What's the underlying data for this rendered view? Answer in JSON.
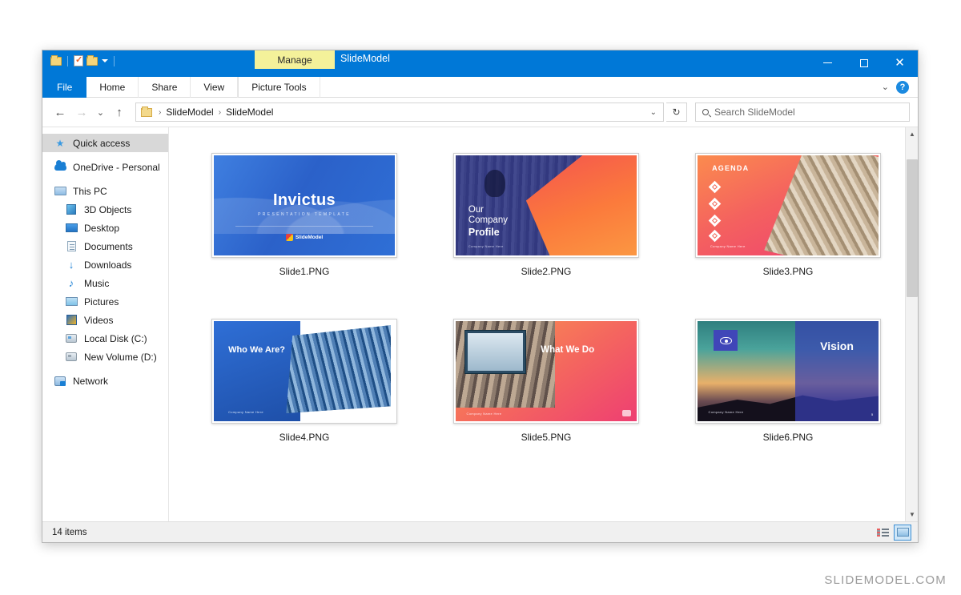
{
  "window": {
    "title": "SlideModel",
    "contextual_tab_group": "Manage",
    "quick_access": [
      {
        "icon": "folder-icon",
        "name": "quick-access-folder"
      },
      {
        "icon": "properties-icon",
        "name": "quick-access-properties"
      },
      {
        "icon": "new-folder-icon",
        "name": "quick-access-new-folder"
      },
      {
        "icon": "chevron-down-icon",
        "name": "quick-access-customize"
      }
    ],
    "controls": {
      "minimize": "minimize-icon",
      "maximize": "maximize-icon",
      "close": "close-icon"
    }
  },
  "ribbon": {
    "tabs": [
      {
        "label": "File",
        "id": "file"
      },
      {
        "label": "Home",
        "id": "home"
      },
      {
        "label": "Share",
        "id": "share"
      },
      {
        "label": "View",
        "id": "view"
      },
      {
        "label": "Picture Tools",
        "id": "picture-tools"
      }
    ],
    "collapse_icon": "chevron-down-icon",
    "help_label": "?"
  },
  "address": {
    "back_icon": "arrow-left-icon",
    "forward_icon": "arrow-right-icon",
    "recent_icon": "chevron-down-icon",
    "up_icon": "arrow-up-icon",
    "breadcrumb": [
      "SlideModel",
      "SlideModel"
    ],
    "separator": "›",
    "dropdown_icon": "chevron-down-icon",
    "refresh_icon": "refresh-icon",
    "search_placeholder": "Search SlideModel",
    "search_value": "",
    "search_icon": "search-icon"
  },
  "sidebar": {
    "items": [
      {
        "label": "Quick access",
        "icon": "star-icon",
        "indent": false,
        "selected": true,
        "gap_before": false
      },
      {
        "label": "OneDrive - Personal",
        "icon": "cloud-icon",
        "indent": false,
        "selected": false,
        "gap_before": true
      },
      {
        "label": "This PC",
        "icon": "pc-icon",
        "indent": false,
        "selected": false,
        "gap_before": true
      },
      {
        "label": "3D Objects",
        "icon": "3d-objects-icon",
        "indent": true,
        "selected": false,
        "gap_before": false
      },
      {
        "label": "Desktop",
        "icon": "desktop-icon",
        "indent": true,
        "selected": false,
        "gap_before": false
      },
      {
        "label": "Documents",
        "icon": "documents-icon",
        "indent": true,
        "selected": false,
        "gap_before": false
      },
      {
        "label": "Downloads",
        "icon": "downloads-icon",
        "indent": true,
        "selected": false,
        "gap_before": false
      },
      {
        "label": "Music",
        "icon": "music-icon",
        "indent": true,
        "selected": false,
        "gap_before": false
      },
      {
        "label": "Pictures",
        "icon": "pictures-icon",
        "indent": true,
        "selected": false,
        "gap_before": false
      },
      {
        "label": "Videos",
        "icon": "videos-icon",
        "indent": true,
        "selected": false,
        "gap_before": false
      },
      {
        "label": "Local Disk (C:)",
        "icon": "disk-icon",
        "indent": true,
        "selected": false,
        "gap_before": false
      },
      {
        "label": "New Volume (D:)",
        "icon": "disk-icon",
        "indent": true,
        "selected": false,
        "gap_before": false
      },
      {
        "label": "Network",
        "icon": "network-icon",
        "indent": false,
        "selected": false,
        "gap_before": true
      }
    ]
  },
  "files": [
    {
      "label": "Slide1.PNG",
      "preview": {
        "id": "invictus",
        "title": "Invictus",
        "subtitle": "PRESENTATION TEMPLATE",
        "logo_text": "SlideModel",
        "bg_color": "#2f6fd6"
      }
    },
    {
      "label": "Slide2.PNG",
      "preview": {
        "id": "company-profile",
        "line1": "Our",
        "line2": "Company",
        "line3": "Profile",
        "footer": "Company Name Here",
        "bg_color": "#262a75",
        "accent_color": "#fb7a3c"
      }
    },
    {
      "label": "Slide3.PNG",
      "preview": {
        "id": "agenda",
        "title": "AGENDA",
        "bullet_count": 4,
        "footer": "Company Name Here",
        "bg_color": "#f4615f"
      }
    },
    {
      "label": "Slide4.PNG",
      "preview": {
        "id": "who-we-are",
        "title": "Who We Are?",
        "footer": "Company Name Here",
        "bg_color": "#2f6fd6"
      }
    },
    {
      "label": "Slide5.PNG",
      "preview": {
        "id": "what-we-do",
        "title": "What We Do",
        "footer": "Company Name Here",
        "bg_color": "#f4655f"
      }
    },
    {
      "label": "Slide6.PNG",
      "preview": {
        "id": "vision",
        "title": "Vision",
        "icon": "eye-icon",
        "footer": "Company Name Here",
        "page_number": "5",
        "bg_color": "#383eb2"
      }
    }
  ],
  "status": {
    "item_count": "14 items",
    "views": [
      {
        "id": "details-view",
        "label": "Details view",
        "active": false
      },
      {
        "id": "large-icons-view",
        "label": "Large icons view",
        "active": true
      }
    ]
  },
  "scrollbar": {
    "up_icon": "chevron-up-icon",
    "down_icon": "chevron-down-icon"
  },
  "watermark": "SLIDEMODEL.COM"
}
